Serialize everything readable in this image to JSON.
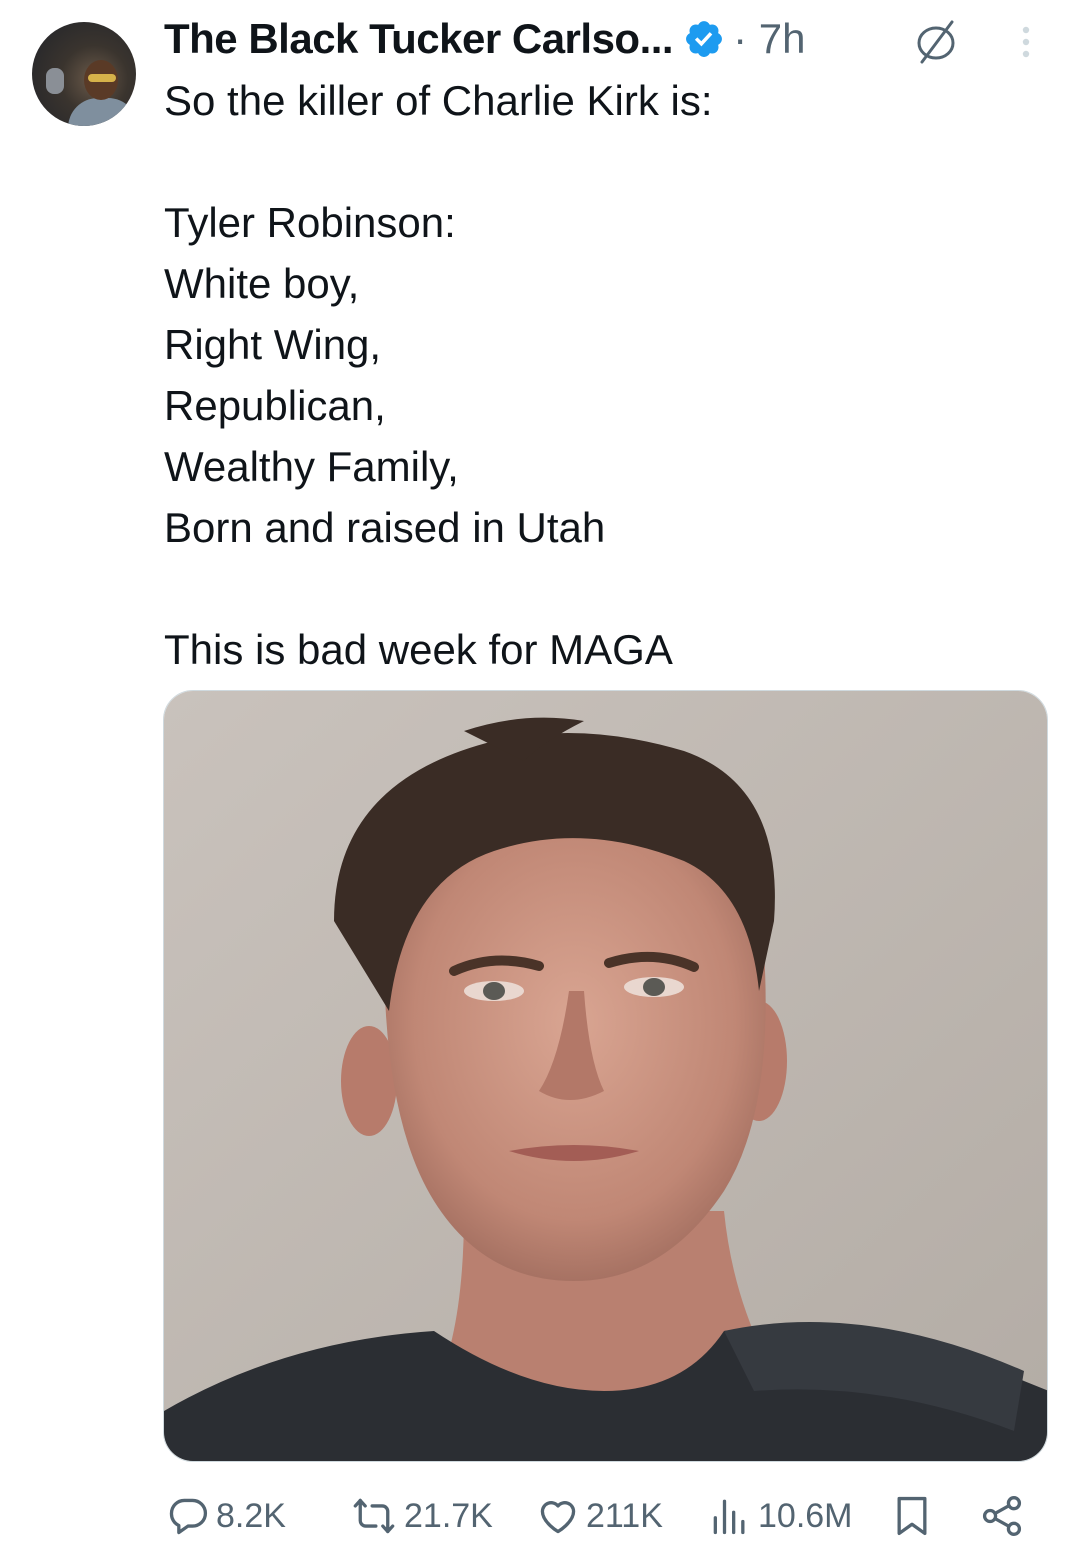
{
  "tweet": {
    "display_name": "The Black Tucker Carlso...",
    "verified": true,
    "time": "· 7h",
    "text": "So the killer of Charlie Kirk is:\n\nTyler Robinson:\nWhite boy,\nRight Wing,\nRepublican,\nWealthy Family,\nBorn and raised in Utah\n\nThis is bad week for MAGA"
  },
  "icons": {
    "verified": "verified-badge-icon",
    "grok": "grok-icon",
    "more": "more-options-icon",
    "reply": "reply-icon",
    "retweet": "retweet-icon",
    "like": "like-icon",
    "views": "views-icon",
    "bookmark": "bookmark-icon",
    "share": "share-icon"
  },
  "stats": {
    "replies": "8.2K",
    "reposts": "21.7K",
    "likes": "211K",
    "views": "10.6M"
  },
  "colors": {
    "text": "#0f1419",
    "secondary": "#536471",
    "verified_blue": "#1d9bf0"
  }
}
